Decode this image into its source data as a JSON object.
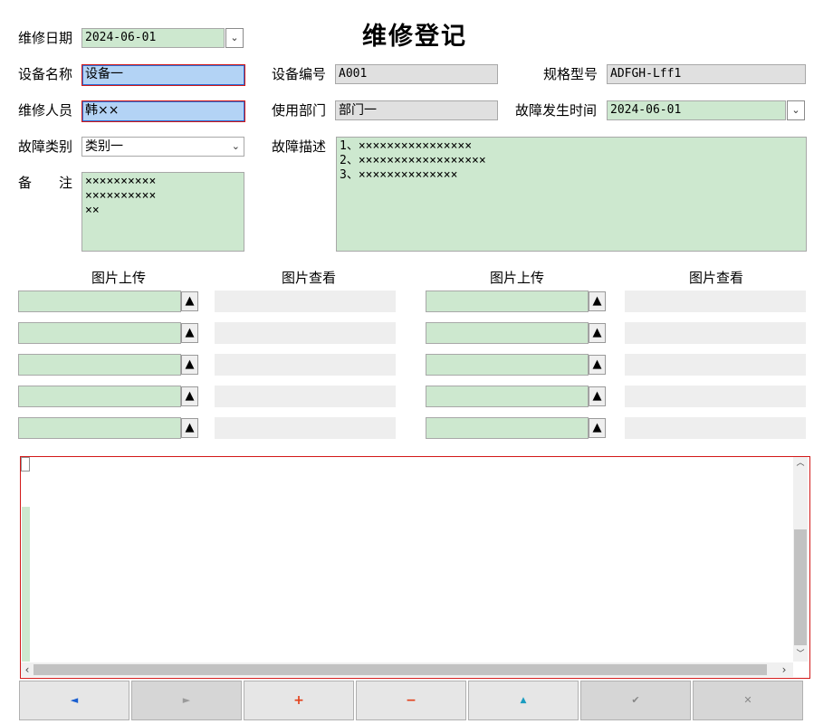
{
  "title": "维修登记",
  "labels": {
    "repair_date": "维修日期",
    "device_name": "设备名称",
    "repairer": "维修人员",
    "fault_type": "故障类别",
    "remark": "备　　注",
    "device_no": "设备编号",
    "department": "使用部门",
    "fault_desc": "故障描述",
    "spec_model": "规格型号",
    "fault_time": "故障发生时间"
  },
  "values": {
    "repair_date": "2024-06-01",
    "device_name": "设备一",
    "repairer": "韩××",
    "fault_type": "类别一",
    "device_no": "A001",
    "department": "部门一",
    "spec_model": "ADFGH-Lff1",
    "fault_time": "2024-06-01",
    "fault_desc": "1、××××××××××××××××\n2、××××××××××××××××××\n3、××××××××××××××",
    "remark": "××××××××××\n××××××××××\n××"
  },
  "images": {
    "upload_label": "图片上传",
    "view_label": "图片查看",
    "upload_button": "▲"
  },
  "nav_buttons": {
    "prev": "◄",
    "next": "►",
    "add": "+",
    "delete": "−",
    "up": "▲",
    "confirm": "✔",
    "cancel": "✕"
  },
  "colors": {
    "field_green": "#cde8cf",
    "field_gray": "#e0e0e0",
    "selected_blue": "#b3d3f5",
    "border_red": "#d21818",
    "nav_blue": "#1a5fd0",
    "nav_red": "#e2401a",
    "nav_teal": "#1a9cc0"
  }
}
